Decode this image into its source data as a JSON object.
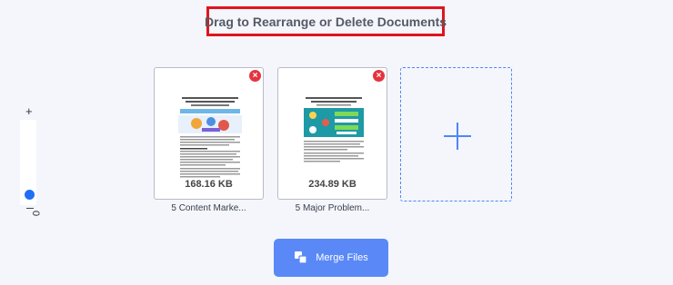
{
  "header": {
    "title": "Drag to Rearrange or Delete Documents"
  },
  "zoom": {
    "plus": "+",
    "value": "0",
    "level": 0
  },
  "files": [
    {
      "size": "168.16 KB",
      "name": "5 Content Marke..."
    },
    {
      "size": "234.89 KB",
      "name": "5 Major Problem..."
    }
  ],
  "close_glyph": "×",
  "merge_button": {
    "label": "Merge Files"
  },
  "colors": {
    "accent": "#5a89f7",
    "close": "#e4343f",
    "highlight": "#e0141e"
  }
}
